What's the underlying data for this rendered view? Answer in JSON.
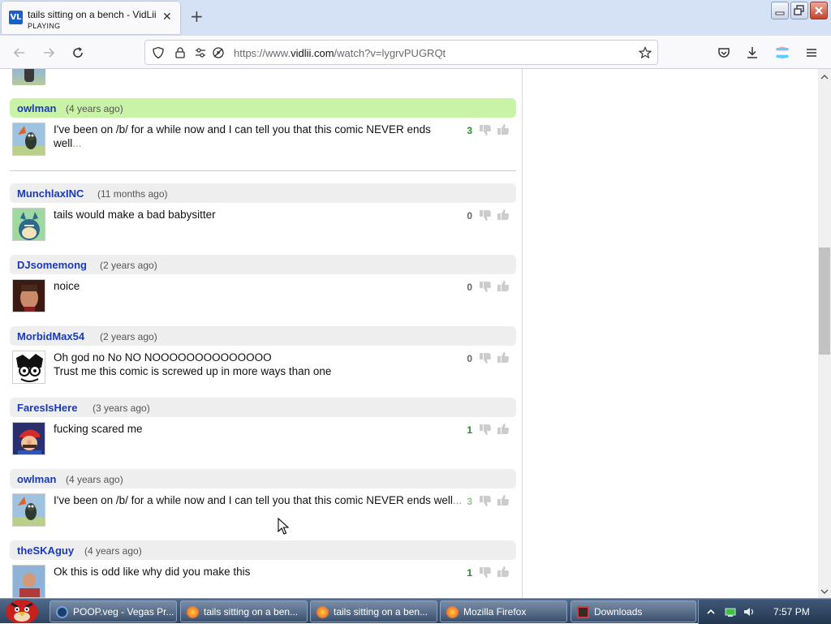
{
  "browser": {
    "tab": {
      "title": "tails sitting on a bench - VidLii",
      "subtitle": "PLAYING",
      "favicon": "VL"
    },
    "url": {
      "prefix": "https://www.",
      "domain": "vidlii.com",
      "path": "/watch?v=lygrvPUGRQt"
    }
  },
  "comments": [
    {
      "user": "owlman",
      "time": "(4 years ago)",
      "text": "I've been on /b/ for a while now and I can tell you that this comic NEVER ends well",
      "more": "...",
      "score": "3",
      "highlight": true,
      "avatar": "owl-avatar"
    },
    {
      "user": "MunchlaxINC",
      "time": "(11 months ago)",
      "text": "tails would make a bad babysitter",
      "more": "",
      "score": "0",
      "highlight": false,
      "avatar": "munchlax-avatar"
    },
    {
      "user": "DJsomemong",
      "time": "(2 years ago)",
      "text": "noice",
      "more": "",
      "score": "0",
      "highlight": false,
      "avatar": "face-avatar"
    },
    {
      "user": "MorbidMax54",
      "time": "(2 years ago)",
      "text": "Oh god no No NO NOOOOOOOOOOOOOO",
      "text2": "Trust me this comic is screwed up in more ways than one",
      "more": "",
      "score": "0",
      "highlight": false,
      "avatar": "cartoon-avatar"
    },
    {
      "user": "FaresIsHere",
      "time": "(3 years ago)",
      "text": "fucking scared me",
      "more": "",
      "score": "1",
      "highlight": false,
      "avatar": "mario-avatar"
    },
    {
      "user": "owlman",
      "time": "(4 years ago)",
      "text": "I've been on /b/ for a while now and I can tell you that this comic NEVER ends well",
      "more": "...",
      "score": "3",
      "highlight": false,
      "avatar": "owl-avatar"
    },
    {
      "user": "theSKAguy",
      "time": "(4 years ago)",
      "text": "Ok this is odd like why did you make this",
      "more": "",
      "score": "1",
      "highlight": false,
      "avatar": "person-avatar"
    }
  ],
  "taskbar": {
    "items": [
      {
        "label": "POOP.veg - Vegas Pr...",
        "icon": "vegas-icon"
      },
      {
        "label": "tails sitting on a ben...",
        "icon": "firefox-icon"
      },
      {
        "label": "tails sitting on a ben...",
        "icon": "firefox-icon"
      },
      {
        "label": "Mozilla Firefox",
        "icon": "firefox-icon"
      },
      {
        "label": "Downloads",
        "icon": "downloads-icon"
      }
    ],
    "clock": "7:57 PM"
  },
  "colors": {
    "username": "#1a3ab8",
    "highlight": "#c9f4a7",
    "score_positive": "#2a8a2a",
    "tab_bar": "#d5e2f5"
  }
}
